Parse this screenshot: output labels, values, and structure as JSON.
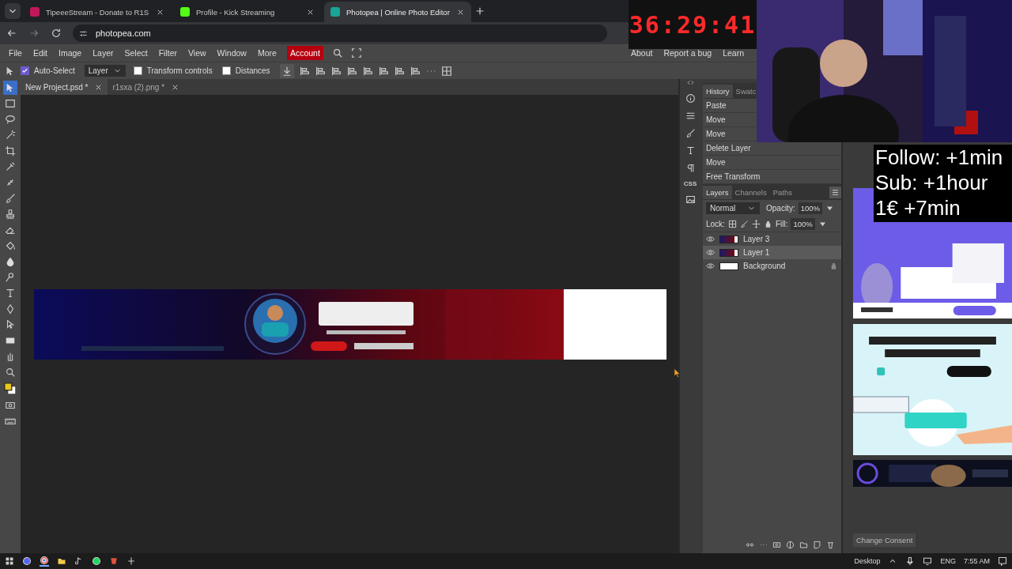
{
  "browser_tabs": [
    {
      "title": "TipeeeStream - Donate to R1S",
      "selected": false,
      "color": "#c2185b"
    },
    {
      "title": "Profile - Kick Streaming",
      "selected": false,
      "color": "#53fc18"
    },
    {
      "title": "Photopea | Online Photo Editor",
      "selected": true,
      "color": "#18a497"
    }
  ],
  "address": "photopea.com",
  "menu": [
    "File",
    "Edit",
    "Image",
    "Layer",
    "Select",
    "Filter",
    "View",
    "Window",
    "More"
  ],
  "account": "Account",
  "links": [
    "About",
    "Report a bug",
    "Learn"
  ],
  "options": {
    "auto_select": {
      "label": "Auto-Select",
      "checked": true
    },
    "target": "Layer",
    "transform_controls": {
      "label": "Transform controls",
      "checked": false
    },
    "distances": {
      "label": "Distances",
      "checked": false
    }
  },
  "documents": [
    {
      "name": "New Project.psd *",
      "selected": true
    },
    {
      "name": "r1sxa (2).png *",
      "selected": false
    }
  ],
  "css_label": "CSS",
  "history": {
    "tabs": [
      {
        "label": "History",
        "selected": true
      },
      {
        "label": "Swatc",
        "selected": false
      }
    ],
    "items": [
      "Paste",
      "Move",
      "Move",
      "Delete Layer",
      "Move",
      "Free Transform"
    ]
  },
  "layers_panel": {
    "tabs": [
      {
        "label": "Layers",
        "selected": true
      },
      {
        "label": "Channels",
        "selected": false
      },
      {
        "label": "Paths",
        "selected": false
      }
    ],
    "blend": "Normal",
    "opacity_label": "Opacity:",
    "opacity": "100%",
    "lock_label": "Lock:",
    "fill_label": "Fill:",
    "fill": "100%",
    "layers": [
      {
        "name": "Layer 3",
        "selected": false,
        "locked": false
      },
      {
        "name": "Layer 1",
        "selected": true,
        "locked": false
      },
      {
        "name": "Background",
        "selected": false,
        "locked": true
      }
    ]
  },
  "stream_overlay": {
    "timer": "36:29:41",
    "rules": [
      "Follow: +1min",
      "Sub: +1hour",
      "1€ +7min"
    ]
  },
  "change_consent": "Change Consent",
  "taskbar": {
    "desktop": "Desktop",
    "language": "ENG",
    "time": "7:55 AM"
  }
}
